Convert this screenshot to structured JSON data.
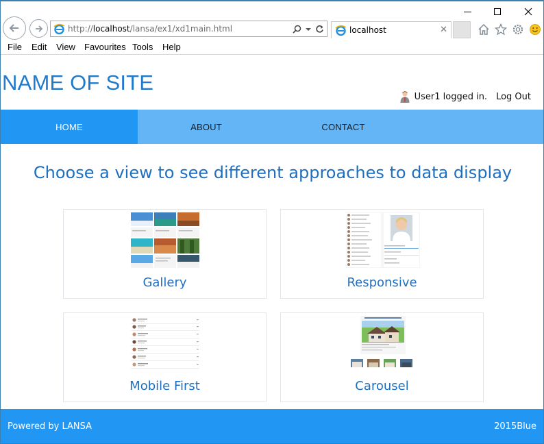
{
  "browser": {
    "url_prefix": "http://",
    "url_host": "localhost",
    "url_path": "/lansa/ex1/xd1main.html",
    "tab_title": "localhost",
    "menu": [
      "File",
      "Edit",
      "View",
      "Favourites",
      "Tools",
      "Help"
    ],
    "icons": {
      "back": "back-arrow-icon",
      "forward": "forward-arrow-icon",
      "search": "search-icon",
      "refresh": "refresh-icon",
      "home": "home-icon",
      "favorites": "star-icon",
      "settings": "gear-icon",
      "feedback": "smiley-icon"
    }
  },
  "site": {
    "name": "NAME OF SITE",
    "user_status": "User1 logged in.",
    "logout_label": "Log Out"
  },
  "nav": {
    "items": [
      {
        "label": "HOME",
        "active": true
      },
      {
        "label": "ABOUT",
        "active": false
      },
      {
        "label": "CONTACT",
        "active": false
      }
    ]
  },
  "main": {
    "heading": "Choose a view to see different approaches to data display",
    "cards": [
      {
        "label": "Gallery"
      },
      {
        "label": "Responsive"
      },
      {
        "label": "Mobile First"
      },
      {
        "label": "Carousel"
      }
    ]
  },
  "footer": {
    "left": "Powered by LANSA",
    "right": "2015Blue"
  },
  "colors": {
    "brand_blue": "#1f7acc",
    "nav_bg": "#64b5f6",
    "nav_active": "#2196f3",
    "footer_bg": "#2196f3",
    "heading": "#1f6fc0"
  }
}
